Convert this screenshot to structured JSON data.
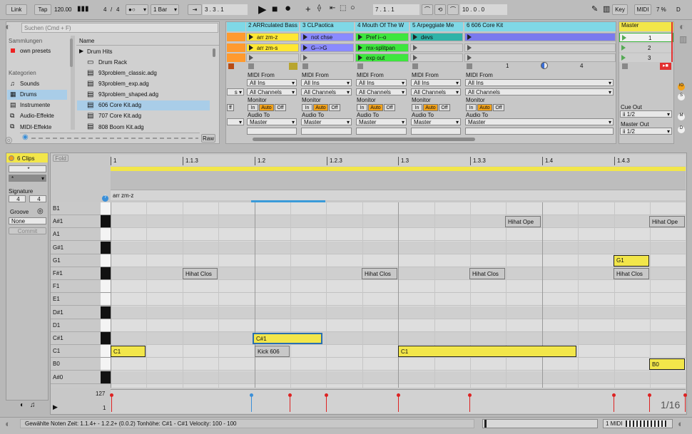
{
  "transport": {
    "link": "Link",
    "tap": "Tap",
    "tempo": "120.00",
    "sig_num": "4",
    "sig_den": "4",
    "quantize": "1 Bar",
    "position": "3 .   3 .   1",
    "loop_start": "7 .   1 .   1",
    "loop_length": "10 .   0 .   0",
    "key": "Key",
    "midi": "MIDI",
    "cpu": "7 %",
    "d": "D"
  },
  "browser": {
    "search_placeholder": "Suchen (Cmd + F)",
    "collections_title": "Sammlungen",
    "collections": [
      "own presets"
    ],
    "categories_title": "Kategorien",
    "categories": [
      "Sounds",
      "Drums",
      "Instrumente",
      "Audio-Effekte",
      "MIDI-Effekte"
    ],
    "name_header": "Name",
    "items": [
      "Drum Hits",
      "Drum Rack",
      "93problem_classic.adg",
      "93problem_exp.adg",
      "93problem_shaped.adg",
      "606 Core Kit.adg",
      "707 Core Kit.adg",
      "808 Boom Kit.adg"
    ],
    "raw": "Raw"
  },
  "tracks": [
    {
      "name": "2 ARRculated Bass",
      "color": "#ffe733",
      "clips": [
        "arr zm-z",
        "arr zm-s",
        ""
      ],
      "midi_from": "All Ins",
      "channels": "All Channels",
      "audio_to": "Master"
    },
    {
      "name": "3 CLPaotica",
      "color": "#8a8aff",
      "clips": [
        "not chse",
        "G-->G",
        ""
      ],
      "midi_from": "All Ins",
      "channels": "All Channels",
      "audio_to": "Master"
    },
    {
      "name": "4 Mouth Of The W",
      "color": "#3ee63e",
      "clips": [
        "Pref i--o",
        "mx-splitpan",
        "exp out"
      ],
      "midi_from": "All Ins",
      "channels": "All Channels",
      "audio_to": "Master"
    },
    {
      "name": "5 Arpeggiate Me",
      "color": "#2fb3a8",
      "clips": [
        "devs",
        "",
        ""
      ],
      "midi_from": "All Ins",
      "channels": "All Channels",
      "audio_to": "Master"
    },
    {
      "name": "6 606 Core Kit",
      "color": "#7a7aee",
      "clips": [
        "",
        "",
        ""
      ],
      "midi_from": "All Ins",
      "channels": "All Channels",
      "audio_to": "Master"
    }
  ],
  "io": {
    "midi_from": "MIDI From",
    "monitor": "Monitor",
    "audio_to": "Audio To",
    "in": "In",
    "auto": "Auto",
    "off": "Off",
    "track_num_left": "1",
    "track_num_right": "4"
  },
  "master": {
    "name": "Master",
    "scenes": [
      "1",
      "2",
      "3"
    ],
    "cue_out": "Cue Out",
    "cue_val": "ii 1/2",
    "master_out": "Master Out",
    "master_val": "ii 1/2"
  },
  "clip": {
    "title": "6 Clips",
    "signature": "Signature",
    "sig_num": "4",
    "sig_den": "4",
    "groove": "Groove",
    "groove_val": "None",
    "commit": "Commit",
    "fold": "Fold",
    "clip_name": "arr zm-z"
  },
  "ruler": [
    "1",
    "1.1.3",
    "1.2",
    "1.2.3",
    "1.3",
    "1.3.3",
    "1.4",
    "1.4.3"
  ],
  "keys": [
    "B1",
    "A#1",
    "A1",
    "G#1",
    "G1",
    "F#1",
    "F1",
    "E1",
    "D#1",
    "D1",
    "C#1",
    "C1",
    "B0",
    "A#0"
  ],
  "notes": [
    {
      "label": "Hihat Ope",
      "row": 1,
      "start": 708,
      "end": 758,
      "sel": false
    },
    {
      "label": "Hihat Ope",
      "row": 1,
      "start": 910,
      "end": 960,
      "sel": false
    },
    {
      "label": "G1",
      "row": 4,
      "start": 860,
      "end": 910,
      "sel": true
    },
    {
      "label": "Hihat Clos",
      "row": 5,
      "start": 256,
      "end": 305,
      "sel": false
    },
    {
      "label": "Hihat Clos",
      "row": 5,
      "start": 507,
      "end": 557,
      "sel": false
    },
    {
      "label": "Hihat Clos",
      "row": 5,
      "start": 658,
      "end": 708,
      "sel": false
    },
    {
      "label": "Hihat Clos",
      "row": 5,
      "start": 860,
      "end": 910,
      "sel": false
    },
    {
      "label": "C#1",
      "row": 10,
      "start": 354,
      "end": 452,
      "sel": true
    },
    {
      "label": "C1",
      "row": 11,
      "start": 155,
      "end": 204,
      "sel": true
    },
    {
      "label": "Kick 606",
      "row": 11,
      "start": 357,
      "end": 406,
      "sel": false
    },
    {
      "label": "C1",
      "row": 11,
      "start": 558,
      "end": 808,
      "sel": true
    },
    {
      "label": "B0",
      "row": 12,
      "start": 910,
      "end": 960,
      "sel": true
    }
  ],
  "velocity": {
    "max": "127",
    "min": "1",
    "grid": "1/16"
  },
  "status": {
    "text": "Gewählte Noten   Zeit: 1.1.4+ - 1.2.2+ (0.0.2)   Tonhöhe: C#1 - C#1   Velocity: 100 - 100",
    "track": "1 MIDI"
  }
}
